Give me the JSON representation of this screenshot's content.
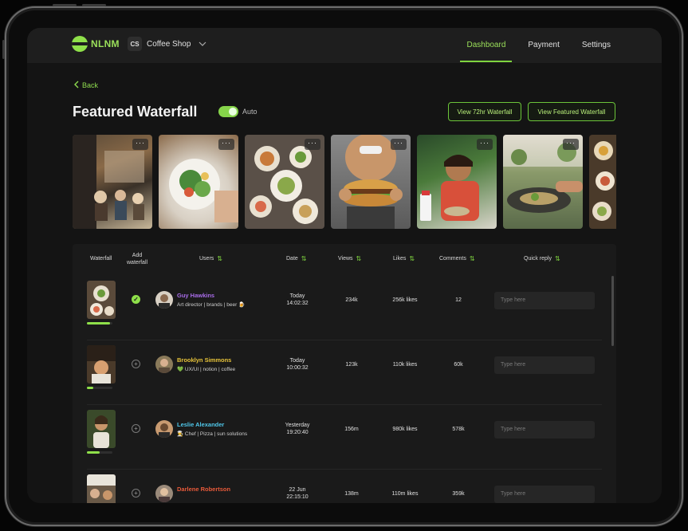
{
  "app": {
    "logo_text": "NLNM",
    "shop_initials": "CS",
    "shop_name": "Coffee Shop"
  },
  "nav": {
    "items": [
      "Dashboard",
      "Payment",
      "Settings"
    ],
    "active": "Dashboard"
  },
  "page": {
    "back_label": "Back",
    "title": "Featured Waterfall",
    "auto_label": "Auto",
    "auto_enabled": true,
    "btn_72hr": "View 72hr Waterfall",
    "btn_featured": "View Featured Waterfall"
  },
  "table": {
    "headers": {
      "waterfall": "Waterfall",
      "add_waterfall": "Add\nwaterfall",
      "users": "Users",
      "date": "Date",
      "views": "Views",
      "likes": "Likes",
      "comments": "Comments",
      "quick_reply": "Quick reply"
    },
    "rows": [
      {
        "name": "Guy Hawkins",
        "name_color": "#a86ce8",
        "bio": "Art director | brands | beer 🍺",
        "date_day": "Today",
        "date_time": "14:02:32",
        "views": "234k",
        "likes": "256k likes",
        "comments": "12",
        "added": true,
        "progress": 0.9,
        "reply_placeholder": "Type here"
      },
      {
        "name": "Brooklyn Simmons",
        "name_color": "#e8c43a",
        "bio": "💚 UX/UI | notion | coffee",
        "date_day": "Today",
        "date_time": "10:00:32",
        "views": "123k",
        "likes": "110k likes",
        "comments": "60k",
        "added": false,
        "progress": 0.25,
        "reply_placeholder": "Type here"
      },
      {
        "name": "Leslie Alexander",
        "name_color": "#4fc6e8",
        "bio": "👨‍🍳 Chef | Pizza | sun solutions",
        "date_day": "Yesterday",
        "date_time": "19:20:40",
        "views": "156m",
        "likes": "980k likes",
        "comments": "578k",
        "added": false,
        "progress": 0.5,
        "reply_placeholder": "Type here"
      },
      {
        "name": "Darlene Robertson",
        "name_color": "#e85a3a",
        "bio": "",
        "date_day": "22 Jun",
        "date_time": "22:15:10",
        "views": "138m",
        "likes": "110m likes",
        "comments": "359k",
        "added": false,
        "progress": 0.4,
        "reply_placeholder": "Type here"
      }
    ]
  },
  "icons": {
    "back": "chevron-left-icon",
    "shop_dropdown": "chevron-down-icon",
    "photo_menu": "more-horizontal-icon",
    "sort": "sort-arrows-icon",
    "add": "plus-circle-icon",
    "added": "check-circle-icon"
  },
  "colors": {
    "accent": "#8fe04a",
    "background": "#141414",
    "topbar": "#1e1e1e"
  }
}
